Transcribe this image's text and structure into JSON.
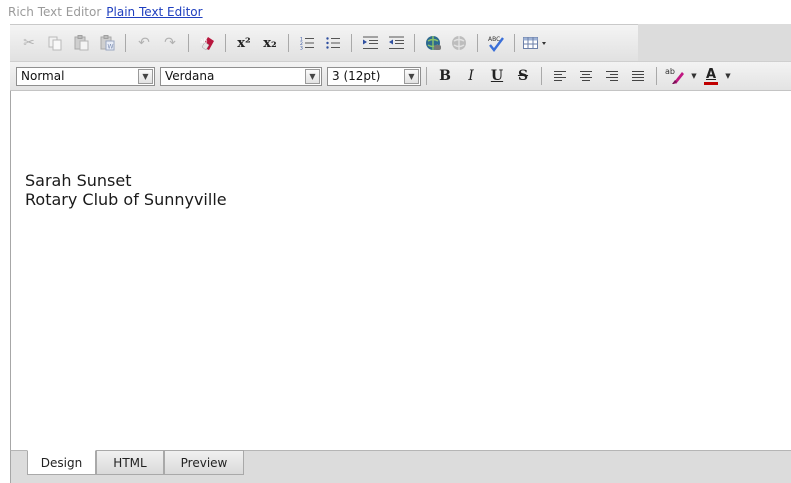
{
  "mode_bar": {
    "current": "Rich Text Editor",
    "alternate": "Plain Text Editor"
  },
  "toolbar1": {
    "icons": [
      "cut-icon",
      "copy-icon",
      "paste-icon",
      "paste-word-icon",
      "undo-icon",
      "redo-icon",
      "spellcheck-eraser-icon",
      "superscript-icon",
      "subscript-icon",
      "numbered-list-icon",
      "bulleted-list-icon",
      "indent-icon",
      "outdent-icon",
      "link-icon",
      "unlink-icon",
      "spell-check-icon",
      "insert-table-icon"
    ],
    "superscript_label": "x²",
    "subscript_label": "x₂"
  },
  "toolbar2": {
    "paragraph_format": "Normal",
    "font_family": "Verdana",
    "font_size": "3 (12pt)",
    "bold_label": "B",
    "italic_label": "I",
    "underline_label": "U",
    "strike_label": "S",
    "font_color_label": "A",
    "highlight_label": "ab"
  },
  "document": {
    "lines": [
      "Sarah Sunset",
      "Rotary Club of Sunnyville"
    ]
  },
  "tabs": [
    {
      "label": "Design",
      "active": true
    },
    {
      "label": "HTML",
      "active": false
    },
    {
      "label": "Preview",
      "active": false
    }
  ],
  "colors": {
    "link": "#1f3fbf",
    "font_color_bar": "#c00000",
    "highlight": "#c01882"
  }
}
